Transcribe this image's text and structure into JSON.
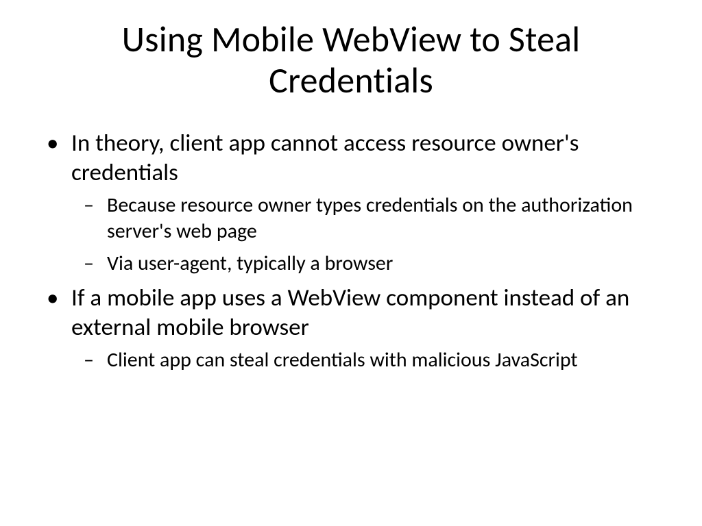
{
  "title": "Using Mobile WebView to Steal Credentials",
  "bullets": [
    {
      "text": "In theory, client app cannot access resource owner's credentials",
      "sub": [
        "Because resource owner types credentials on the authorization server's web page",
        "Via user-agent, typically a browser"
      ]
    },
    {
      "text": "If a mobile app uses a WebView  component instead of an external mobile browser",
      "sub": [
        "Client app can steal credentials with malicious JavaScript"
      ]
    }
  ]
}
